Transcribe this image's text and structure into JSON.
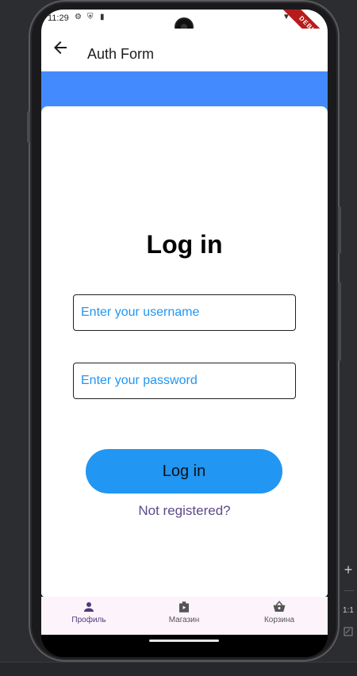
{
  "status_bar": {
    "time": "11:29",
    "debug_banner": "DEBUG"
  },
  "app_bar": {
    "title": "Auth Form",
    "back_icon": "arrow-back-icon"
  },
  "form": {
    "heading": "Log in",
    "username_placeholder": "Enter your username",
    "password_placeholder": "Enter your password",
    "login_button": "Log in",
    "register_link": "Not registered?"
  },
  "bottom_nav": {
    "items": [
      {
        "label": "Профиль",
        "icon": "person-icon",
        "active": true
      },
      {
        "label": "Магазин",
        "icon": "shop-icon",
        "active": false
      },
      {
        "label": "Корзина",
        "icon": "basket-icon",
        "active": false
      }
    ]
  },
  "emulator_tools": {
    "zoom_ratio": "1:1"
  },
  "colors": {
    "accent_blue": "#2196f3",
    "header_blue": "#448aff",
    "link_purple": "#5c4a8a",
    "nav_background": "#fdf4fb"
  }
}
